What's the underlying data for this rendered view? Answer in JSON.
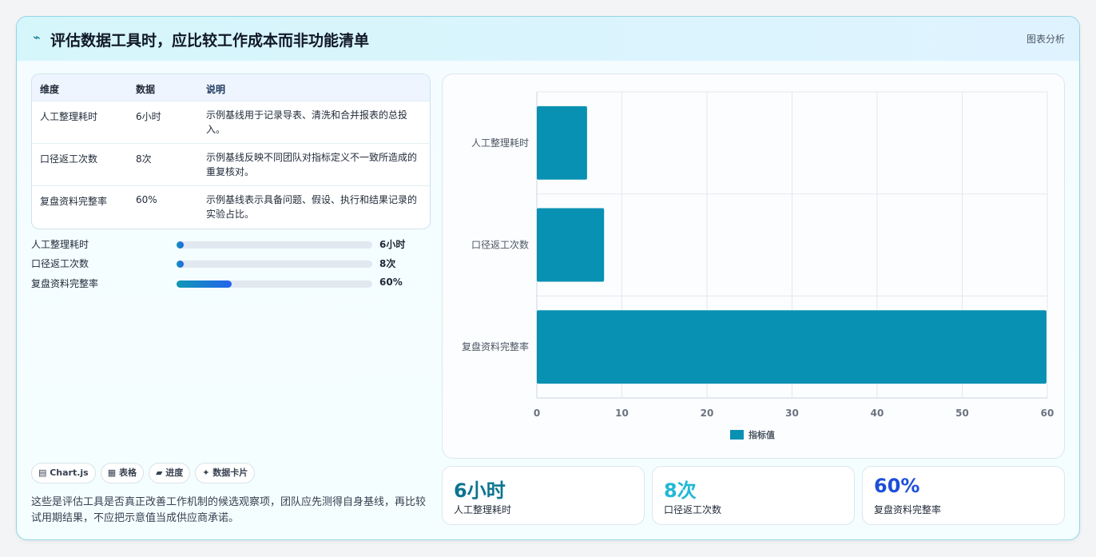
{
  "header": {
    "icon": "sparkline-icon",
    "title": "评估数据工具时，应比较工作成本而非功能清单",
    "tag": "图表分析"
  },
  "table": {
    "headers": [
      "维度",
      "数据",
      "说明"
    ],
    "rows": [
      {
        "dim": "人工整理耗时",
        "data": "6小时",
        "note": "示例基线用于记录导表、清洗和合并报表的总投入。"
      },
      {
        "dim": "口径返工次数",
        "data": "8次",
        "note": "示例基线反映不同团队对指标定义不一致所造成的重复核对。"
      },
      {
        "dim": "复盘资料完整率",
        "data": "60%",
        "note": "示例基线表示具备问题、假设、执行和结果记录的实验占比。"
      }
    ]
  },
  "progress": [
    {
      "label": "人工整理耗时",
      "value": "6小时",
      "fraction": 0.0
    },
    {
      "label": "口径返工次数",
      "value": "8次",
      "fraction": 0.0
    },
    {
      "label": "复盘资料完整率",
      "value": "60%",
      "fraction": 0.28
    }
  ],
  "chips": [
    "▤ Chart.js",
    "▦ 表格",
    "▰ 进度",
    "✦ 数据卡片"
  ],
  "description": "这些是评估工具是否真正改善工作机制的候选观察项，团队应先测得自身基线，再比较试用期结果，不应把示意值当成供应商承诺。",
  "chart_data": {
    "type": "bar",
    "orientation": "horizontal",
    "categories": [
      "人工整理耗时",
      "口径返工次数",
      "复盘资料完整率"
    ],
    "series": [
      {
        "name": "指标值",
        "values": [
          6,
          8,
          60
        ],
        "color": "#0891b2"
      }
    ],
    "xlim": [
      0,
      60
    ],
    "xticks": [
      0,
      10,
      20,
      30,
      40,
      50,
      60
    ],
    "grid": true,
    "legend": "bottom"
  },
  "kpis": [
    {
      "value": "6小时",
      "label": "人工整理耗时",
      "color": "#0e7490"
    },
    {
      "value": "8次",
      "label": "口径返工次数",
      "color": "#22b8d6"
    },
    {
      "value": "60%",
      "label": "复盘资料完整率",
      "color": "#1d4ed8"
    }
  ]
}
